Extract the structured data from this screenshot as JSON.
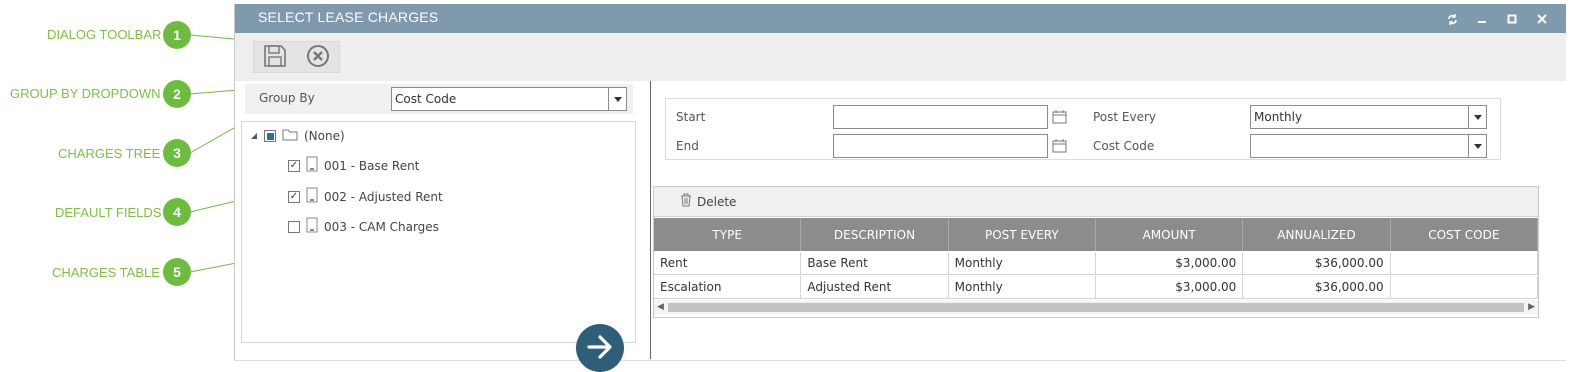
{
  "annotations": [
    {
      "num": "1",
      "label": "DIALOG TOOLBAR"
    },
    {
      "num": "2",
      "label": "GROUP BY DROPDOWN"
    },
    {
      "num": "3",
      "label": "CHARGES TREE"
    },
    {
      "num": "4",
      "label": "DEFAULT FIELDS"
    },
    {
      "num": "5",
      "label": "CHARGES TABLE"
    }
  ],
  "dialog": {
    "title": "SELECT LEASE CHARGES",
    "window_buttons": [
      "restore-icon",
      "minimize-icon",
      "maximize-icon",
      "close-icon"
    ]
  },
  "toolbar": {
    "buttons": [
      {
        "icon": "save-icon"
      },
      {
        "icon": "cancel-icon"
      }
    ]
  },
  "group_by": {
    "label": "Group By",
    "value": "Cost Code"
  },
  "tree": {
    "root": {
      "label": "(None)",
      "checked": "partial"
    },
    "items": [
      {
        "label": "001 - Base Rent",
        "checked": true
      },
      {
        "label": "002 - Adjusted Rent",
        "checked": true
      },
      {
        "label": "003 - CAM Charges",
        "checked": false
      }
    ]
  },
  "defaults": {
    "start_label": "Start",
    "start_value": "",
    "end_label": "End",
    "end_value": "",
    "post_every_label": "Post Every",
    "post_every_value": "Monthly",
    "cost_code_label": "Cost Code",
    "cost_code_value": ""
  },
  "grid": {
    "delete_label": "Delete",
    "columns": [
      "TYPE",
      "DESCRIPTION",
      "POST EVERY",
      "AMOUNT",
      "ANNUALIZED",
      "COST CODE"
    ],
    "rows": [
      [
        "Rent",
        "Base Rent",
        "Monthly",
        "$3,000.00",
        "$36,000.00",
        ""
      ],
      [
        "Escalation",
        "Adjusted Rent",
        "Monthly",
        "$3,000.00",
        "$36,000.00",
        ""
      ]
    ]
  },
  "colors": {
    "annotation": "#6cbd3e",
    "titlebar": "#7f9aad",
    "grid_header": "#8c8c8c",
    "go_button": "#2e5f78"
  }
}
